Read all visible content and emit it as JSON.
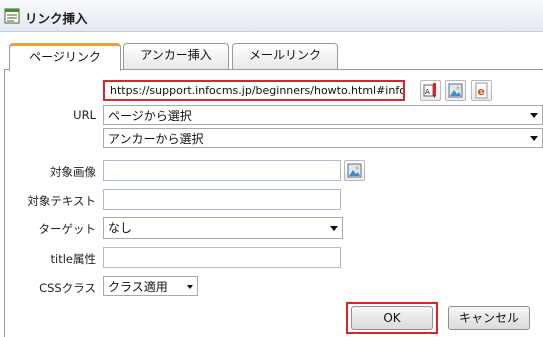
{
  "window": {
    "title": "リンク挿入"
  },
  "tabs": [
    {
      "label": "ページリンク",
      "active": true
    },
    {
      "label": "アンカー挿入",
      "active": false
    },
    {
      "label": "メールリンク",
      "active": false
    }
  ],
  "form": {
    "url": {
      "label": "URL",
      "value": "https://support.infocms.jp/beginners/howto.html#info",
      "page_select": "ページから選択",
      "anchor_select": "アンカーから選択",
      "icons": [
        "link-properties-icon",
        "image-icon",
        "edit-icon"
      ]
    },
    "target_image": {
      "label": "対象画像",
      "value": ""
    },
    "target_text": {
      "label": "対象テキスト",
      "value": ""
    },
    "target": {
      "label": "ターゲット",
      "value": "なし"
    },
    "title_attr": {
      "label": "title属性",
      "value": ""
    },
    "css_class": {
      "label": "CSSクラス",
      "value": "クラス適用"
    }
  },
  "buttons": {
    "ok": "OK",
    "cancel": "キャンセル"
  },
  "colors": {
    "highlight": "#d9262c",
    "active_tab": "#f0a030"
  }
}
